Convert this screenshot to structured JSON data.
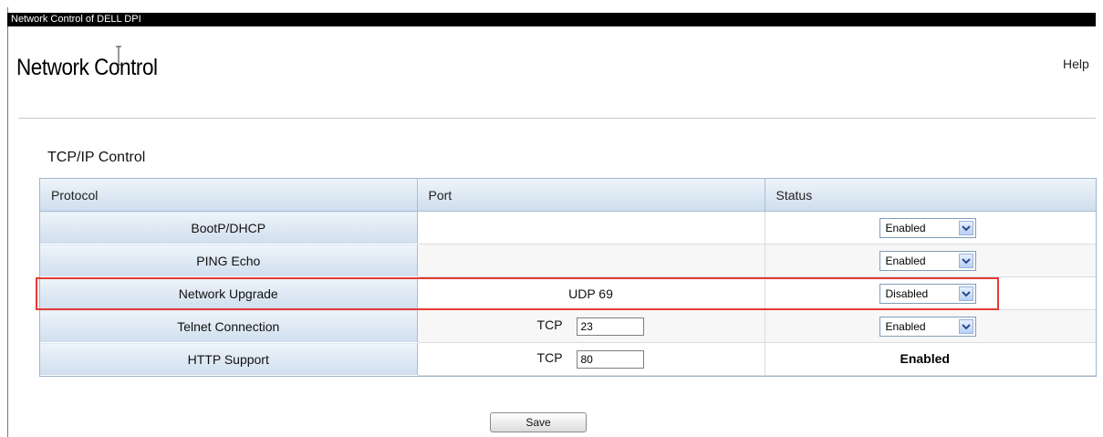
{
  "window": {
    "title": "Network Control of DELL DPI"
  },
  "header": {
    "page_title": "Network Control",
    "help_label": "Help"
  },
  "section": {
    "title": "TCP/IP Control"
  },
  "table": {
    "columns": [
      "Protocol",
      "Port",
      "Status"
    ],
    "rows": [
      {
        "protocol": "BootP/DHCP",
        "port_prefix": "",
        "port_value": "",
        "status": "Enabled"
      },
      {
        "protocol": "PING Echo",
        "port_prefix": "",
        "port_value": "",
        "status": "Enabled"
      },
      {
        "protocol": "Network Upgrade",
        "port_prefix": "UDP 69",
        "port_value": "",
        "status": "Disabled"
      },
      {
        "protocol": "Telnet Connection",
        "port_prefix": "TCP",
        "port_value": "23",
        "status": "Enabled"
      },
      {
        "protocol": "HTTP Support",
        "port_prefix": "TCP",
        "port_value": "80",
        "status": "Enabled"
      }
    ]
  },
  "footer": {
    "save_label": "Save"
  },
  "colors": {
    "highlight": "#e53935",
    "header_gradient_top": "#eef4fa",
    "header_gradient_bottom": "#cfdeee"
  },
  "icons": {
    "dropdown": "chevron-down-icon",
    "cursor": "text-cursor-icon"
  }
}
